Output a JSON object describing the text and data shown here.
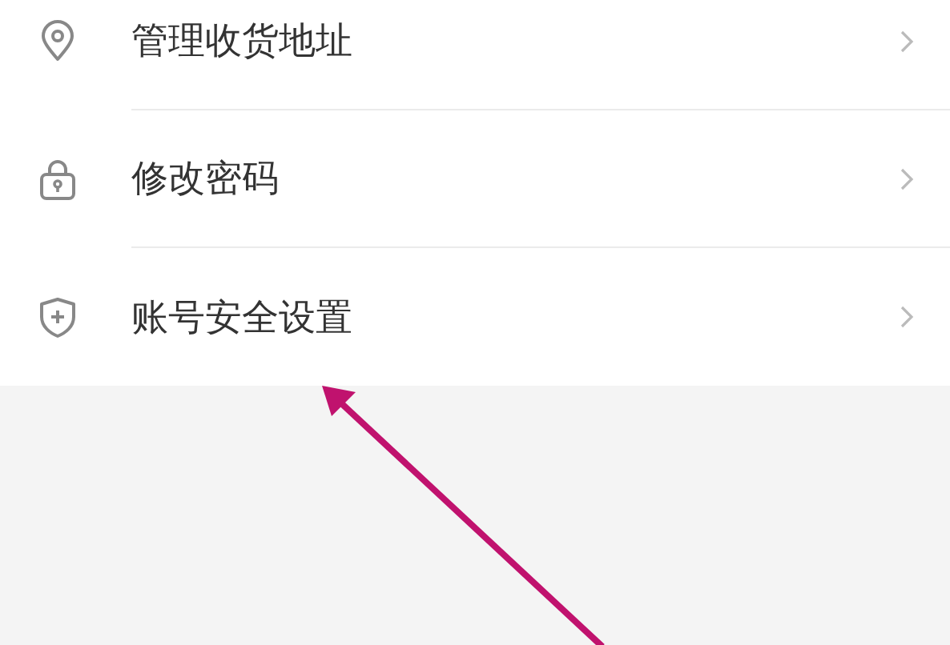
{
  "settings_items": [
    {
      "kind": "location",
      "label": "管理收货地址"
    },
    {
      "kind": "lock",
      "label": "修改密码"
    },
    {
      "kind": "shield",
      "label": "账号安全设置"
    }
  ],
  "annotation": {
    "kind": "arrow"
  }
}
